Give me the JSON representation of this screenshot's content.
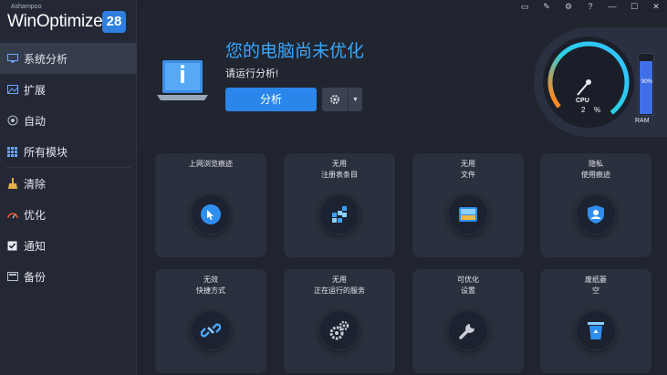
{
  "brand": {
    "vendor": "Ashampoo",
    "name": "WinOptimizer",
    "version": "28"
  },
  "topbar": {
    "icons": [
      "chat-icon",
      "edit-icon",
      "settings-icon",
      "help-icon",
      "minimize-icon",
      "maximize-icon",
      "close-icon"
    ],
    "glyphs": [
      "▭",
      "✎",
      "⚙",
      "?",
      "—",
      "☐",
      "✕"
    ]
  },
  "sidebar": {
    "items": [
      {
        "label": "系统分析",
        "icon": "monitor-icon",
        "active": true
      },
      {
        "label": "扩展",
        "icon": "image-icon"
      },
      {
        "label": "自动",
        "icon": "auto-icon"
      },
      {
        "label": "所有模块",
        "icon": "grid-icon"
      },
      {
        "label": "清除",
        "icon": "broom-icon"
      },
      {
        "label": "优化",
        "icon": "speedometer-icon"
      },
      {
        "label": "通知",
        "icon": "check-icon"
      },
      {
        "label": "备份",
        "icon": "backup-icon"
      }
    ]
  },
  "hero": {
    "title": "您的电脑尚未优化",
    "subtitle": "请运行分析!",
    "analyze_label": "分析"
  },
  "gauge": {
    "cpu_label": "CPU",
    "cpu_value": "2",
    "cpu_unit": "%",
    "ram_label": "RAM",
    "ram_value": "90%",
    "ram_fraction": 0.9
  },
  "tiles": [
    {
      "label": "上网浏览痕迹",
      "icon": "browser-traces-icon"
    },
    {
      "label": "无用\n注册表条目",
      "icon": "registry-icon"
    },
    {
      "label": "无用\n文件",
      "icon": "files-icon"
    },
    {
      "label": "隐私\n使用痕迹",
      "icon": "privacy-shield-icon"
    },
    {
      "label": "无效\n快捷方式",
      "icon": "broken-link-icon"
    },
    {
      "label": "无用\n正在运行的服务",
      "icon": "services-gears-icon"
    },
    {
      "label": "可优化\n设置",
      "icon": "wrench-icon"
    },
    {
      "label": "废纸篓\n空",
      "icon": "recycle-bin-icon"
    }
  ],
  "colors": {
    "accent": "#2a86ea",
    "title": "#38a7ff",
    "bg": "#1f2430",
    "tile": "#2a303d"
  }
}
